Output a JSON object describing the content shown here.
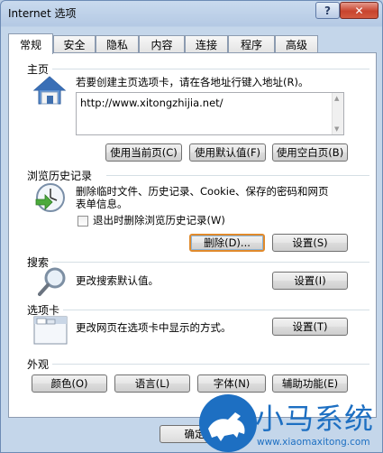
{
  "window": {
    "title": "Internet 选项",
    "help_label": "?",
    "close_label": "✕"
  },
  "tabs": [
    {
      "label": "常规"
    },
    {
      "label": "安全"
    },
    {
      "label": "隐私"
    },
    {
      "label": "内容"
    },
    {
      "label": "连接"
    },
    {
      "label": "程序"
    },
    {
      "label": "高级"
    }
  ],
  "home": {
    "section_title": "主页",
    "instruction": "若要创建主页选项卡，请在各地址行键入地址(R)。",
    "url": "http://www.xitongzhijia.net/",
    "use_current": "使用当前页(C)",
    "use_default": "使用默认值(F)",
    "use_blank": "使用空白页(B)"
  },
  "history": {
    "section_title": "浏览历史记录",
    "description_line1": "删除临时文件、历史记录、Cookie、保存的密码和网页",
    "description_line2": "表单信息。",
    "delete_on_exit_label": "退出时删除浏览历史记录(W)",
    "delete_on_exit_checked": false,
    "delete_button": "删除(D)...",
    "settings_button": "设置(S)"
  },
  "search": {
    "section_title": "搜索",
    "description": "更改搜索默认值。",
    "settings_button": "设置(I)"
  },
  "tabs_section": {
    "section_title": "选项卡",
    "description": "更改网页在选项卡中显示的方式。",
    "settings_button": "设置(T)"
  },
  "appearance": {
    "section_title": "外观",
    "colors_button": "颜色(O)",
    "languages_button": "语言(L)",
    "fonts_button": "字体(N)",
    "accessibility_button": "辅助功能(E)"
  },
  "footer": {
    "ok_button": "确定"
  },
  "watermark": {
    "brand": "小马系统",
    "url": "www.xiaomaxitong.com"
  }
}
